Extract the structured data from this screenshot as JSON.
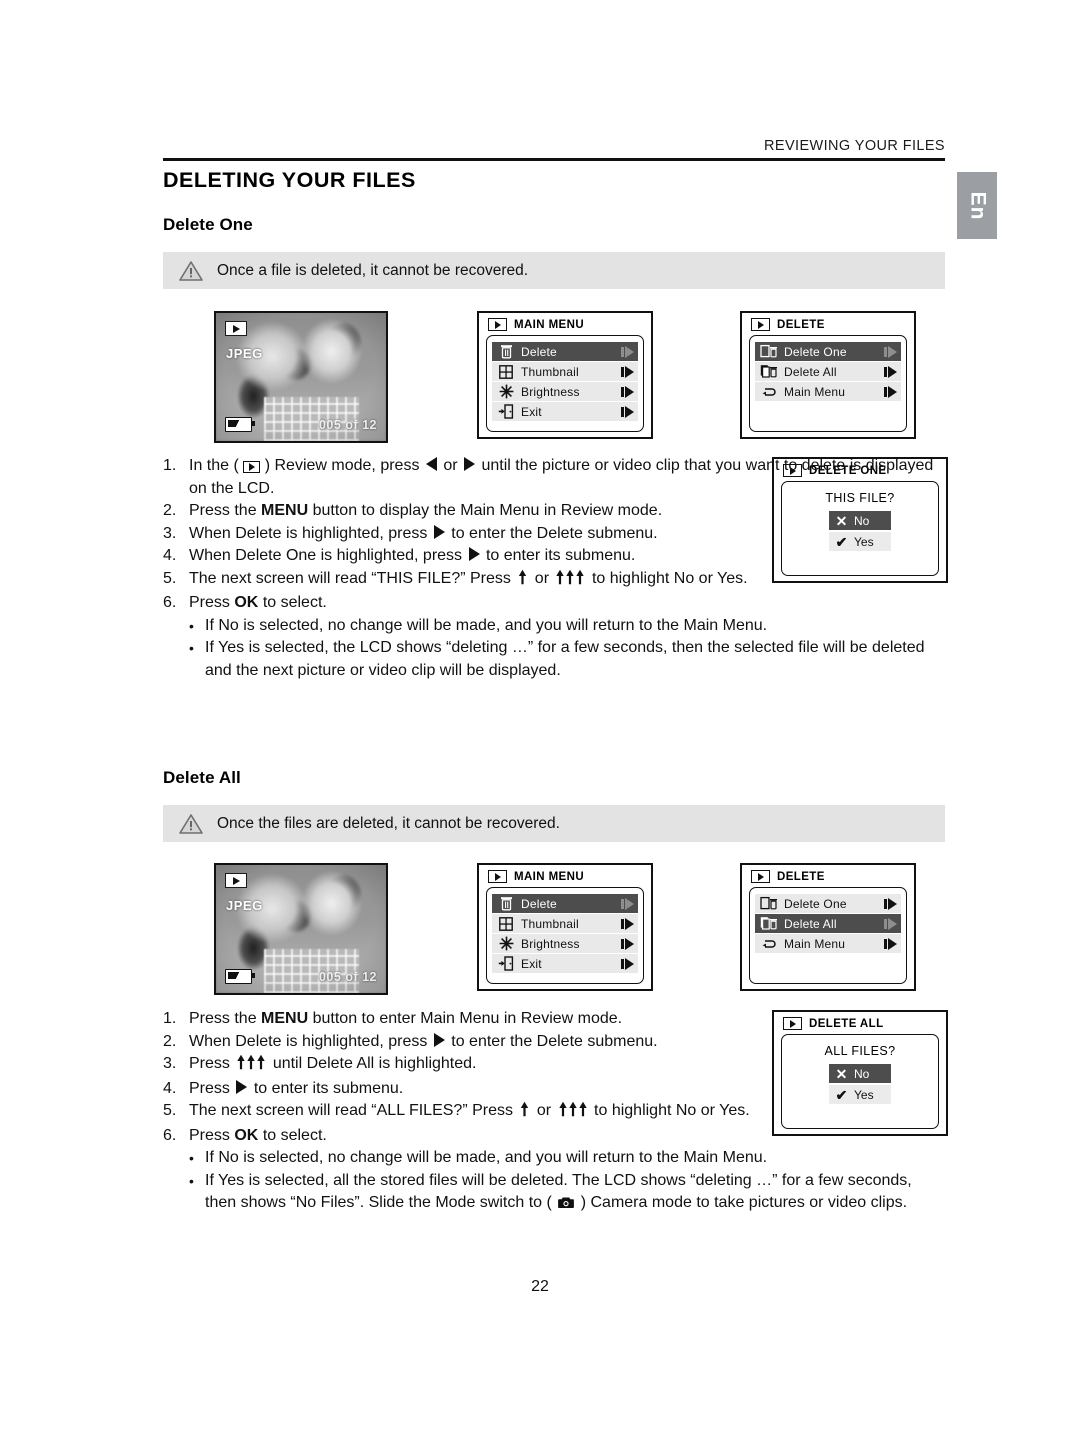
{
  "header": {
    "running_head": "REVIEWING YOUR FILES",
    "language_tab": "En"
  },
  "page_title": "DELETING YOUR FILES",
  "page_number": "22",
  "sections": [
    {
      "heading": "Delete One",
      "note": "Once a file is deleted, it cannot be recovered.",
      "lcd_photo": {
        "mode_icon": "play-icon",
        "format": "JPEG",
        "battery_icon": "battery-icon",
        "counter": "005 of 12"
      },
      "main_menu": {
        "title": "MAIN MENU",
        "items": [
          {
            "label": "Delete",
            "icon": "trash-icon",
            "selected": true
          },
          {
            "label": "Thumbnail",
            "icon": "grid-icon",
            "selected": false
          },
          {
            "label": "Brightness",
            "icon": "sunburst-icon",
            "selected": false
          },
          {
            "label": "Exit",
            "icon": "exit-door-icon",
            "selected": false
          }
        ]
      },
      "delete_menu": {
        "title": "DELETE",
        "items": [
          {
            "label": "Delete One",
            "icon": "single-file-trash-icon",
            "selected": true
          },
          {
            "label": "Delete All",
            "icon": "multi-file-trash-icon",
            "selected": false
          },
          {
            "label": "Main Menu",
            "icon": "return-arrow-icon",
            "selected": false
          }
        ]
      },
      "confirm": {
        "title": "DELETE ONE",
        "question": "THIS FILE?",
        "options": [
          {
            "label": "No",
            "glyph": "✕",
            "selected": true
          },
          {
            "label": "Yes",
            "glyph": "✔",
            "selected": false
          }
        ]
      }
    },
    {
      "heading": "Delete All",
      "note": "Once the files are deleted, it cannot be recovered.",
      "lcd_photo": {
        "mode_icon": "play-icon",
        "format": "JPEG",
        "battery_icon": "battery-icon",
        "counter": "005 of 12"
      },
      "main_menu": {
        "title": "MAIN MENU",
        "items": [
          {
            "label": "Delete",
            "icon": "trash-icon",
            "selected": true
          },
          {
            "label": "Thumbnail",
            "icon": "grid-icon",
            "selected": false
          },
          {
            "label": "Brightness",
            "icon": "sunburst-icon",
            "selected": false
          },
          {
            "label": "Exit",
            "icon": "exit-door-icon",
            "selected": false
          }
        ]
      },
      "delete_menu": {
        "title": "DELETE",
        "items": [
          {
            "label": "Delete One",
            "icon": "single-file-trash-icon",
            "selected": false
          },
          {
            "label": "Delete All",
            "icon": "multi-file-trash-icon",
            "selected": true
          },
          {
            "label": "Main Menu",
            "icon": "return-arrow-icon",
            "selected": false
          }
        ]
      },
      "confirm": {
        "title": "DELETE ALL",
        "question": "ALL FILES?",
        "options": [
          {
            "label": "No",
            "glyph": "✕",
            "selected": true
          },
          {
            "label": "Yes",
            "glyph": "✔",
            "selected": false
          }
        ]
      }
    }
  ],
  "steps_one": {
    "s1a": "In the (",
    "s1b": ") Review mode, press",
    "s1c": "or",
    "s1d": "until the picture or video clip that you want to delete is displayed on the LCD.",
    "s2a": "Press the",
    "s2b": "MENU",
    "s2c": "button to display the Main Menu in Review mode.",
    "s3a": "When Delete is highlighted, press",
    "s3b": "to enter the Delete submenu.",
    "s4a": "When Delete One is highlighted, press",
    "s4b": "to enter its submenu.",
    "s5a": "The next screen will read “THIS FILE?”  Press",
    "s5b": "or",
    "s5c": "to highlight No or Yes.",
    "s6a": "Press",
    "s6b": "OK",
    "s6c": "to select.",
    "b1": "If No is selected, no change will be made, and you will return to the Main Menu.",
    "b2": "If Yes is selected, the LCD shows “deleting …” for a few seconds, then the selected file will be deleted and the next picture or video clip will be displayed.",
    "numbers": [
      "1.",
      "2.",
      "3.",
      "4.",
      "5.",
      "6."
    ],
    "bullet": "•"
  },
  "steps_all": {
    "s1a": "Press the",
    "s1b": "MENU",
    "s1c": "button to enter Main Menu in Review mode.",
    "s2a": "When Delete is highlighted, press",
    "s2b": "to enter the Delete submenu.",
    "s3a": "Press",
    "s3b": "until Delete All is highlighted.",
    "s4a": "Press",
    "s4b": "to enter its submenu.",
    "s5a": "The next screen will read “ALL FILES?”  Press",
    "s5b": "or",
    "s5c": "to highlight No or Yes.",
    "s6a": "Press",
    "s6b": "OK",
    "s6c": "to select.",
    "b1": "If No is selected, no change will be made, and you will return to the Main Menu.",
    "b2a": "If Yes is selected, all the stored files will be deleted. The LCD shows “deleting …” for a few seconds, then shows “No Files”. Slide the Mode switch to (",
    "b2b": ") Camera mode to take pictures or video clips.",
    "numbers": [
      "1.",
      "2.",
      "3.",
      "4.",
      "5.",
      "6."
    ],
    "bullet": "•"
  },
  "colors": {
    "note_bar": "#e3e3e3",
    "menu_row": "#e9e9e9",
    "menu_row_selected": "#4d4d4d",
    "lang_tab": "#9b9fa3",
    "rule": "#111111"
  }
}
